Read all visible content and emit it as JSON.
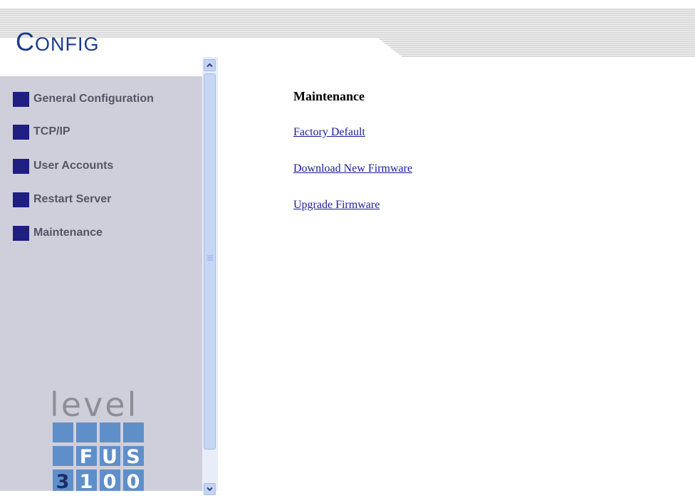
{
  "header": {
    "title_initial": "C",
    "title_rest": "ONFIG"
  },
  "sidebar": {
    "items": [
      {
        "label": "General Configuration"
      },
      {
        "label": "TCP/IP"
      },
      {
        "label": "User Accounts"
      },
      {
        "label": "Restart Server"
      },
      {
        "label": "Maintenance"
      }
    ],
    "logo": {
      "word": "level",
      "row2": "FUS",
      "row3": "3100"
    }
  },
  "main": {
    "heading": "Maintenance",
    "links": [
      {
        "label": "Factory Default"
      },
      {
        "label": "Download New Firmware"
      },
      {
        "label": "Upgrade Firmware"
      }
    ]
  },
  "colors": {
    "title": "#1a3a8f",
    "nav_square": "#1e1f80",
    "sidebar_bg": "#cfcfdb",
    "link": "#1c1c9c",
    "logo_tile": "#5f8fc9"
  },
  "icons": [
    "chevron-up-icon",
    "chevron-down-icon",
    "grip-icon"
  ]
}
